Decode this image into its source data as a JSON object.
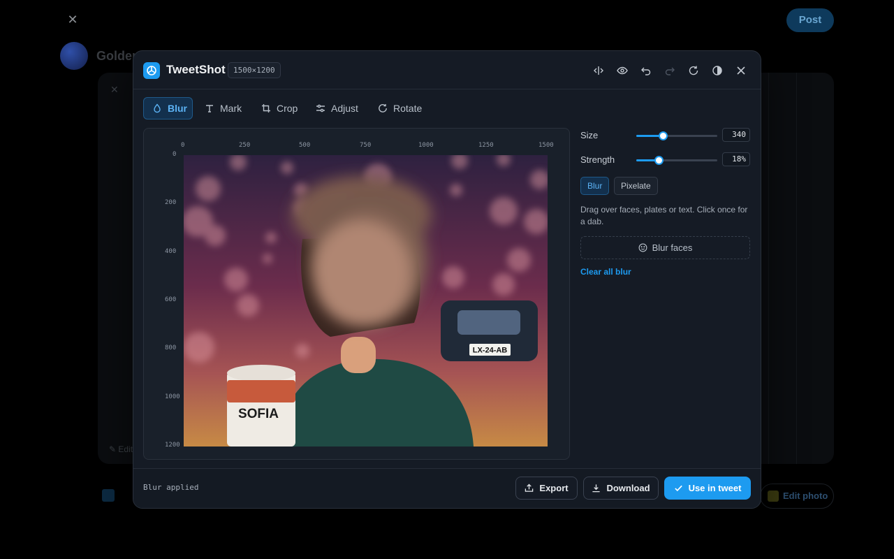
{
  "background": {
    "post_label": "Post",
    "author_name": "Golden",
    "edit_photo_label": "Edit photo",
    "card_edit_label": "✎ Edit"
  },
  "editor": {
    "app_name": "TweetShot",
    "dimensions": "1500×1200",
    "header_icons": [
      "compare-icon",
      "preview-eye-icon",
      "undo-icon",
      "redo-icon",
      "reset-icon",
      "contrast-icon",
      "close-icon"
    ],
    "tabs": [
      {
        "label": "Blur",
        "icon": "droplet-icon",
        "active": true
      },
      {
        "label": "Mark",
        "icon": "text-icon",
        "active": false
      },
      {
        "label": "Crop",
        "icon": "crop-icon",
        "active": false
      },
      {
        "label": "Adjust",
        "icon": "sliders-icon",
        "active": false
      },
      {
        "label": "Rotate",
        "icon": "rotate-icon",
        "active": false
      }
    ],
    "ruler_x": [
      "0",
      "250",
      "500",
      "750",
      "1000",
      "1250",
      "1500"
    ],
    "ruler_y": [
      "0",
      "200",
      "400",
      "600",
      "800",
      "1000",
      "1200"
    ],
    "photo": {
      "plate_text": "LX-24-AB",
      "mug_text": "SOFIA"
    },
    "controls": {
      "size_label": "Size",
      "size_value": "340",
      "size_fraction": 0.33,
      "strength_label": "Strength",
      "strength_value": "18%",
      "strength_fraction": 0.28,
      "modes": [
        {
          "label": "Blur",
          "active": true
        },
        {
          "label": "Pixelate",
          "active": false
        }
      ],
      "hint": "Drag over faces, plates or text. Click once for a dab.",
      "blur_faces_label": "Blur faces",
      "clear_label": "Clear all blur"
    },
    "footer": {
      "status": "Blur applied",
      "export_label": "Export",
      "download_label": "Download",
      "use_label": "Use in tweet"
    },
    "colors": {
      "accent": "#1d9bf0",
      "panel": "#151b25"
    }
  }
}
